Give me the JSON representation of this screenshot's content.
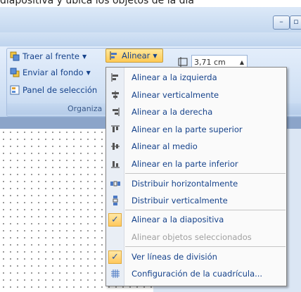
{
  "caption": "diapositiva y ubica los objetos de la dia",
  "window": {
    "minimize": "–"
  },
  "ribbon": {
    "traer": "Traer al frente",
    "enviar": "Enviar al fondo",
    "panel": "Panel de selección",
    "alinear": "Alinear",
    "group_label": "Organiza",
    "width_value": "3,71 cm"
  },
  "menu": {
    "items": [
      {
        "label": "Alinear a la izquierda",
        "icon": "align-left-icon"
      },
      {
        "label": "Alinear verticalmente",
        "icon": "align-center-icon"
      },
      {
        "label": "Alinear a la derecha",
        "icon": "align-right-icon"
      },
      {
        "label": "Alinear en la parte superior",
        "icon": "align-top-icon"
      },
      {
        "label": "Alinear al medio",
        "icon": "align-middle-icon"
      },
      {
        "label": "Alinear en la parte inferior",
        "icon": "align-bottom-icon"
      },
      {
        "label": "Distribuir horizontalmente",
        "icon": "distribute-horizontal-icon"
      },
      {
        "label": "Distribuir verticalmente",
        "icon": "distribute-vertical-icon"
      },
      {
        "label": "Alinear a la diapositiva",
        "icon": "checkmark-icon",
        "checked": true
      },
      {
        "label": "Alinear objetos seleccionados",
        "disabled": true
      },
      {
        "label": "Ver líneas de división",
        "icon": "checkmark-icon",
        "checked": true
      },
      {
        "label": "Configuración de la cuadrícula...",
        "icon": "grid-icon"
      }
    ]
  }
}
